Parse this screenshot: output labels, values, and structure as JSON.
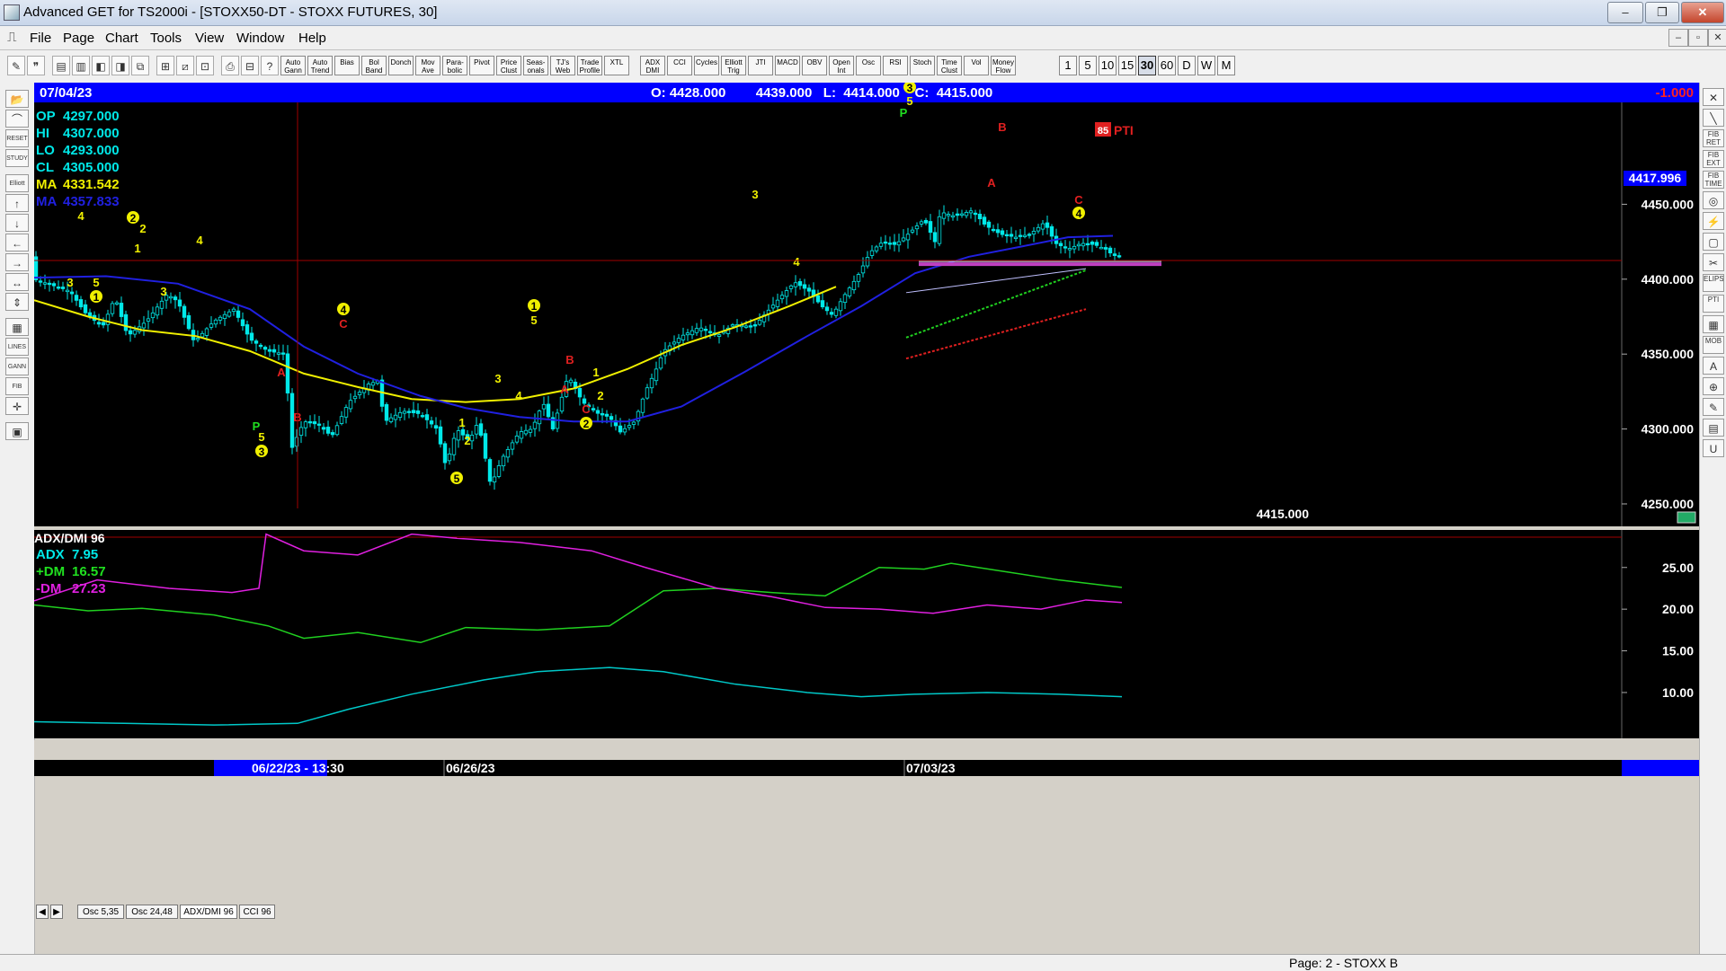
{
  "window": {
    "title": "Advanced GET for TS2000i - [STOXX50-DT - STOXX FUTURES, 30]",
    "minimize": "‒",
    "restore": "❐",
    "close": "✕"
  },
  "menu": {
    "items": [
      "File",
      "Page",
      "Chart",
      "Tools",
      "View",
      "Window",
      "Help"
    ],
    "mdi": [
      "‒",
      "▫",
      "✕"
    ]
  },
  "toolbar": {
    "icons": [
      "✎",
      "❞",
      "▤",
      "▥",
      "◧",
      "◨",
      "⧉",
      "⊞",
      "⧄",
      "⊡",
      "⎙",
      "⊟",
      "?",
      "↖"
    ],
    "studies": [
      "Auto Gann",
      "Auto Trend",
      "Bias",
      "Bol Band",
      "Donch",
      "Mov Ave",
      "Para-bolic",
      "Pivot",
      "Price Clust",
      "Seas-onals",
      "TJ's Web",
      "Trade Profile",
      "XTL",
      "ADX DMI",
      "CCI",
      "Cycles",
      "Elliott Trig",
      "JTI",
      "MACD",
      "OBV",
      "Open Int",
      "Osc",
      "RSI",
      "Stoch",
      "Time Clust",
      "Vol",
      "Money Flow"
    ],
    "timeframes": [
      "1",
      "5",
      "10",
      "15",
      "30",
      "60",
      "D",
      "W",
      "M"
    ],
    "active_timeframe": "30"
  },
  "left_tools": [
    "📂",
    "⌒",
    "RESET",
    "STUDY",
    "Elliott",
    "↑",
    "↓",
    "←",
    "→",
    "↔",
    "⇕",
    "▦",
    "LINES",
    "GANN",
    "FIB",
    "✛",
    "▣"
  ],
  "right_tools": [
    "✕",
    "╲",
    "FIB RET",
    "FIB EXT",
    "FIB TIME",
    "◎",
    "⚡",
    "▢",
    "✂",
    "ELIPS",
    "PTI",
    "▦",
    "MOB",
    "A",
    "⊕",
    "✎",
    "▤",
    "U"
  ],
  "price_panel": {
    "header_date": "07/04/23",
    "header_ohlc": "O: 4428.000        4439.000   L:  4414.000    C:  4415.000",
    "header_change": "-1.000",
    "info": [
      {
        "label": "OP",
        "value": "4297.000",
        "color": "#00e8e8"
      },
      {
        "label": "HI",
        "value": "4307.000",
        "color": "#00e8e8"
      },
      {
        "label": "LO",
        "value": "4293.000",
        "color": "#00e8e8"
      },
      {
        "label": "CL",
        "value": "4305.000",
        "color": "#00e8e8"
      },
      {
        "label": "MA",
        "value": "4331.542",
        "color": "#f0f000"
      },
      {
        "label": "MA",
        "value": "4357.833",
        "color": "#2020e0"
      }
    ],
    "y_ticks": [
      "4450.000",
      "4400.000",
      "4350.000",
      "4300.000",
      "4250.000"
    ],
    "current_price": "4417.996",
    "last_close": "4415.000",
    "pti_value": "85",
    "pti_label": "PTI",
    "price_range": [
      4235,
      4518
    ]
  },
  "elliott_labels": [
    {
      "t": "4",
      "c": "#f0f000",
      "x": 90,
      "y": 244
    },
    {
      "t": "3",
      "c": "#f0f000",
      "x": 78,
      "y": 318
    },
    {
      "t": "5",
      "c": "#f0f000",
      "x": 107,
      "y": 318
    },
    {
      "t": "1",
      "c": "#f0f000",
      "x": 107,
      "y": 334,
      "circ": true
    },
    {
      "t": "2",
      "c": "#f0f000",
      "x": 148,
      "y": 246,
      "circ": true
    },
    {
      "t": "2",
      "c": "#f0f000",
      "x": 159,
      "y": 258
    },
    {
      "t": "1",
      "c": "#f0f000",
      "x": 153,
      "y": 280
    },
    {
      "t": "3",
      "c": "#f0f000",
      "x": 182,
      "y": 328
    },
    {
      "t": "4",
      "c": "#f0f000",
      "x": 222,
      "y": 271
    },
    {
      "t": "A",
      "c": "#e02020",
      "x": 313,
      "y": 418
    },
    {
      "t": "B",
      "c": "#e02020",
      "x": 331,
      "y": 468
    },
    {
      "t": "C",
      "c": "#e02020",
      "x": 382,
      "y": 364
    },
    {
      "t": "4",
      "c": "#f0f000",
      "x": 382,
      "y": 348,
      "circ": true
    },
    {
      "t": "P",
      "c": "#20e020",
      "x": 285,
      "y": 478
    },
    {
      "t": "5",
      "c": "#f0f000",
      "x": 291,
      "y": 490
    },
    {
      "t": "3",
      "c": "#f0f000",
      "x": 291,
      "y": 506,
      "circ": true
    },
    {
      "t": "1",
      "c": "#f0f000",
      "x": 514,
      "y": 474
    },
    {
      "t": "2",
      "c": "#f0f000",
      "x": 520,
      "y": 494
    },
    {
      "t": "5",
      "c": "#f0f000",
      "x": 508,
      "y": 536,
      "circ": true
    },
    {
      "t": "3",
      "c": "#f0f000",
      "x": 554,
      "y": 425
    },
    {
      "t": "4",
      "c": "#f0f000",
      "x": 577,
      "y": 444
    },
    {
      "t": "1",
      "c": "#f0f000",
      "x": 594,
      "y": 344,
      "circ": true
    },
    {
      "t": "5",
      "c": "#f0f000",
      "x": 594,
      "y": 360
    },
    {
      "t": "B",
      "c": "#e02020",
      "x": 634,
      "y": 404
    },
    {
      "t": "A",
      "c": "#e02020",
      "x": 628,
      "y": 437
    },
    {
      "t": "1",
      "c": "#f0f000",
      "x": 663,
      "y": 418
    },
    {
      "t": "2",
      "c": "#f0f000",
      "x": 668,
      "y": 444
    },
    {
      "t": "C",
      "c": "#e02020",
      "x": 652,
      "y": 459
    },
    {
      "t": "2",
      "c": "#f0f000",
      "x": 652,
      "y": 475,
      "circ": true
    },
    {
      "t": "3",
      "c": "#f0f000",
      "x": 840,
      "y": 220
    },
    {
      "t": "4",
      "c": "#f0f000",
      "x": 886,
      "y": 295
    },
    {
      "t": "3",
      "c": "#f0f000",
      "x": 1012,
      "y": 101,
      "circ": true
    },
    {
      "t": "5",
      "c": "#f0f000",
      "x": 1012,
      "y": 116
    },
    {
      "t": "P",
      "c": "#20e020",
      "x": 1005,
      "y": 129
    },
    {
      "t": "B",
      "c": "#e02020",
      "x": 1115,
      "y": 145
    },
    {
      "t": "A",
      "c": "#e02020",
      "x": 1103,
      "y": 207
    },
    {
      "t": "C",
      "c": "#e02020",
      "x": 1200,
      "y": 226
    },
    {
      "t": "4",
      "c": "#f0f000",
      "x": 1200,
      "y": 241,
      "circ": true
    }
  ],
  "adx_panel": {
    "title": "ADX/DMI 96",
    "info": [
      {
        "label": "ADX",
        "value": "7.95",
        "color": "#00e8e8"
      },
      {
        "label": "+DM",
        "value": "16.57",
        "color": "#20e020"
      },
      {
        "label": "-DM",
        "value": "27.23",
        "color": "#e020e0"
      }
    ],
    "y_ticks": [
      "25.00",
      "20.00",
      "15.00",
      "10.00"
    ],
    "value_range": [
      4.5,
      29.5
    ]
  },
  "x_axis": {
    "labels": [
      "06/22/23 - 13:30",
      "06/26/23",
      "07/03/23"
    ]
  },
  "indicator_tabs": [
    "◀",
    "▶",
    "Osc 5,35",
    "Osc 24,48",
    "ADX/DMI 96",
    "CCI 96"
  ],
  "status": {
    "page": "Page: 2 - STOXX B"
  },
  "colors": {
    "chart_bg": "#000000",
    "candle": "#00e8e8",
    "ma_fast": "#f0f000",
    "ma_slow": "#2020e0",
    "header_bg": "#0000ff",
    "support_line": "#c040c0",
    "pti_channel_upper": "#20d020",
    "pti_channel_lower": "#e02020",
    "crosshair": "#a00000"
  }
}
